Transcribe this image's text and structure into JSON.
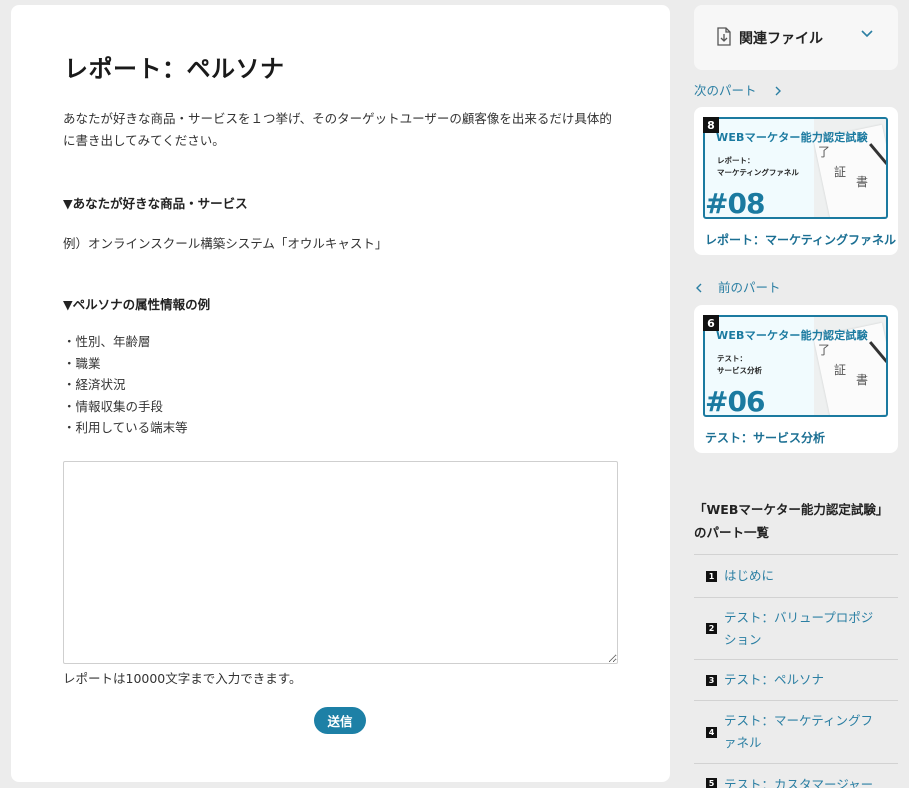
{
  "main": {
    "title": "レポート：ペルソナ",
    "intro": "あなたが好きな商品・サービスを１つ挙げ、そのターゲットユーザーの顧客像を出来るだけ具体的に書き出してみてください。",
    "section1_heading": "▼あなたが好きな商品・サービス",
    "section1_example": "例）オンラインスクール構築システム「オウルキャスト」",
    "section2_heading": "▼ペルソナの属性情報の例",
    "attributes": [
      "・性別、年齢層",
      "・職業",
      "・経済状況",
      "・情報収集の手段",
      "・利用している端末等"
    ],
    "textarea_value": "",
    "hint": "レポートは10000文字まで入力できます。",
    "submit_label": "送信"
  },
  "sidebar": {
    "related_files_label": "関連ファイル",
    "next_part_label": "次のパート",
    "prev_part_label": "前のパート",
    "next_card": {
      "badge": "8",
      "thumb_title": "WEBマーケター能力認定試験",
      "thumb_sub_line1": "レポート：",
      "thumb_sub_line2": "マーケティングファネル",
      "thumb_number": "#08",
      "caption": "レポート：マーケティングファネル"
    },
    "prev_card": {
      "badge": "6",
      "thumb_title": "WEBマーケター能力認定試験",
      "thumb_sub_line1": "テスト：",
      "thumb_sub_line2": "サービス分析",
      "thumb_number": "#06",
      "caption": "テスト：サービス分析"
    },
    "cert_kanji": [
      "了",
      "証",
      "書"
    ],
    "parts_heading_line1": "「WEBマーケター能力認定試験」",
    "parts_heading_line2": "のパート一覧",
    "parts": [
      {
        "num": "1",
        "label": "はじめに"
      },
      {
        "num": "2",
        "label": "テスト：バリュープロポジション"
      },
      {
        "num": "3",
        "label": "テスト：ペルソナ"
      },
      {
        "num": "4",
        "label": "テスト：マーケティングファネル"
      },
      {
        "num": "5",
        "label": "テスト：カスタマージャー"
      }
    ]
  },
  "colors": {
    "accent": "#1d80a6",
    "link": "#2b7fa3",
    "background": "#ececec"
  }
}
